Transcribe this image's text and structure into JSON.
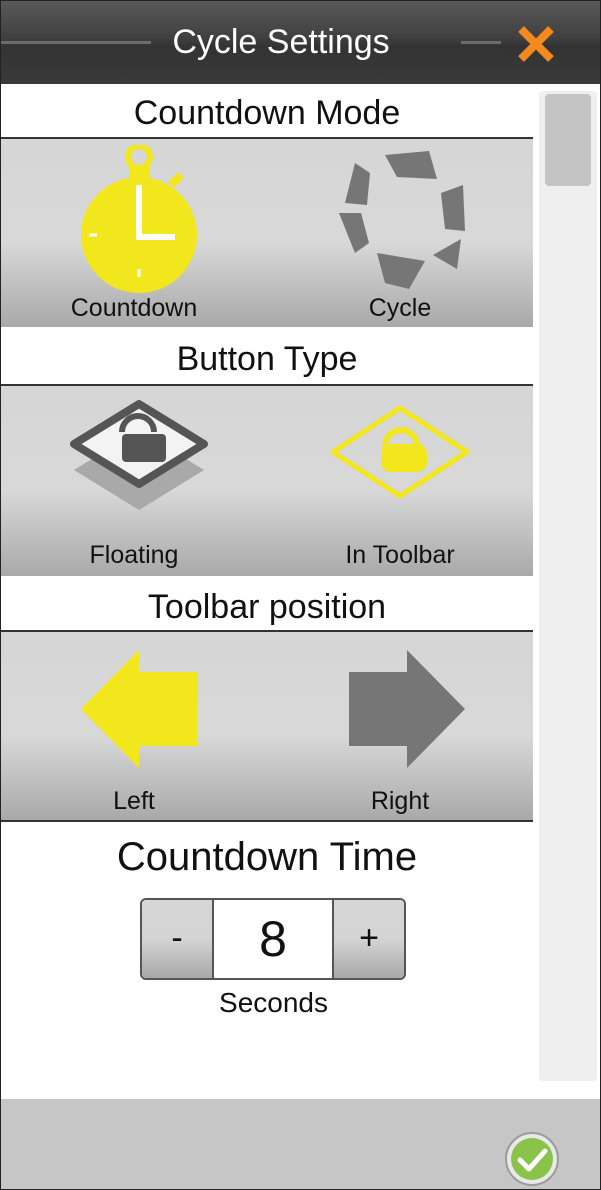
{
  "title": "Cycle Settings",
  "colors": {
    "accent": "#F2E61C",
    "inactive": "#767676",
    "close": "#F28A1E",
    "ok": "#8BC34A"
  },
  "sections": {
    "countdown_mode": {
      "title": "Countdown Mode",
      "options": [
        {
          "label": "Countdown",
          "icon": "stopwatch-icon",
          "selected": true
        },
        {
          "label": "Cycle",
          "icon": "cycle-arrows-icon",
          "selected": false
        }
      ]
    },
    "button_type": {
      "title": "Button Type",
      "options": [
        {
          "label": "Floating",
          "icon": "floating-lock-icon",
          "selected": false
        },
        {
          "label": "In Toolbar",
          "icon": "toolbar-lock-icon",
          "selected": true
        }
      ]
    },
    "toolbar_position": {
      "title": "Toolbar position",
      "options": [
        {
          "label": "Left",
          "icon": "arrow-left-icon",
          "selected": true
        },
        {
          "label": "Right",
          "icon": "arrow-right-icon",
          "selected": false
        }
      ]
    },
    "countdown_time": {
      "title": "Countdown Time",
      "minus_label": "-",
      "value": "8",
      "plus_label": "+",
      "unit": "Seconds"
    }
  },
  "footer": {
    "ok_icon": "check-circle-icon"
  },
  "close_icon": "close-x-icon"
}
